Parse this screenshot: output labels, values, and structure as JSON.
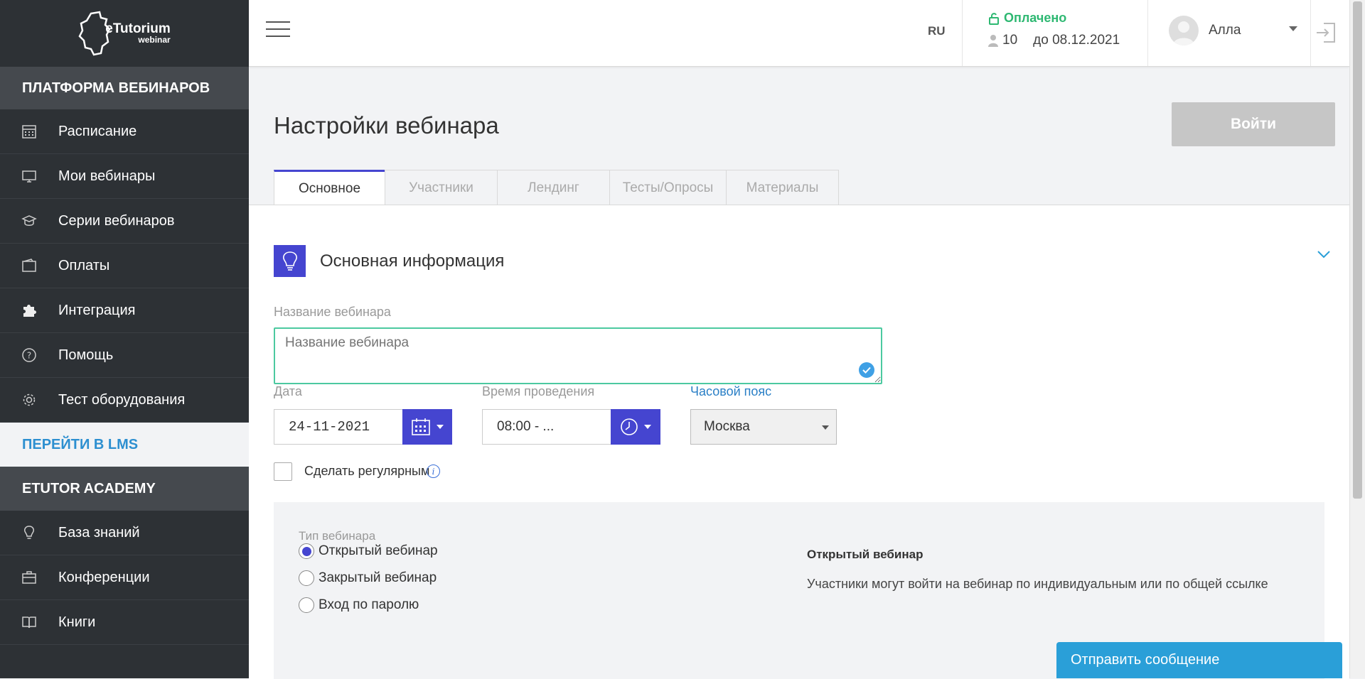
{
  "logo": {
    "brand": "eTutorium",
    "sub": "webinar"
  },
  "sidebar": {
    "section_platform": "ПЛАТФОРМА ВЕБИНАРОВ",
    "items": [
      {
        "label": "Расписание",
        "icon": "calendar-icon"
      },
      {
        "label": "Мои вебинары",
        "icon": "monitor-icon"
      },
      {
        "label": "Серии вебинаров",
        "icon": "graduation-cap-icon"
      },
      {
        "label": "Оплаты",
        "icon": "wallet-icon"
      },
      {
        "label": "Интеграция",
        "icon": "puzzle-icon"
      },
      {
        "label": "Помощь",
        "icon": "question-icon"
      },
      {
        "label": "Тест оборудования",
        "icon": "gear-icon"
      }
    ],
    "lms_link": "ПЕРЕЙТИ В LMS",
    "section_academy": "ETUTOR ACADEMY",
    "academy_items": [
      {
        "label": "База знаний",
        "icon": "lightbulb-icon"
      },
      {
        "label": "Конференции",
        "icon": "briefcase-icon"
      },
      {
        "label": "Книги",
        "icon": "book-icon"
      }
    ]
  },
  "header": {
    "lang": "RU",
    "paid_status": "Оплачено",
    "participants": "10",
    "valid_until": "до 08.12.2021",
    "user_name": "Алла"
  },
  "page": {
    "title": "Настройки вебинара",
    "enter_button": "Войти",
    "tabs": [
      "Основное",
      "Участники",
      "Лендинг",
      "Тесты/Опросы",
      "Материалы"
    ],
    "active_tab": "Основное"
  },
  "form": {
    "section_title": "Основная информация",
    "name_label": "Название вебинара",
    "name_placeholder": "Название вебинара",
    "name_value": "",
    "date_label": "Дата",
    "date_value": "24-11-2021",
    "time_label": "Время проведения",
    "time_value": "08:00 - ...",
    "tz_label": "Часовой пояс",
    "tz_value": "Москва",
    "regular_label": "Сделать регулярным",
    "regular_checked": false,
    "type_label": "Тип вебинара",
    "type_options": [
      "Открытый вебинар",
      "Закрытый вебинар",
      "Вход по паролю"
    ],
    "type_selected": "Открытый вебинар",
    "type_desc_title": "Открытый вебинар",
    "type_desc": "Участники могут войти на вебинар по индивидуальным или по общей ссылке"
  },
  "chat": {
    "label": "Отправить сообщение"
  },
  "colors": {
    "sidebar_bg": "#2d3135",
    "accent": "#4545d0",
    "paid": "#2eb872",
    "lms_link": "#2d8fd0",
    "chat": "#2a9fd8",
    "input_valid": "#4cc9a0"
  }
}
